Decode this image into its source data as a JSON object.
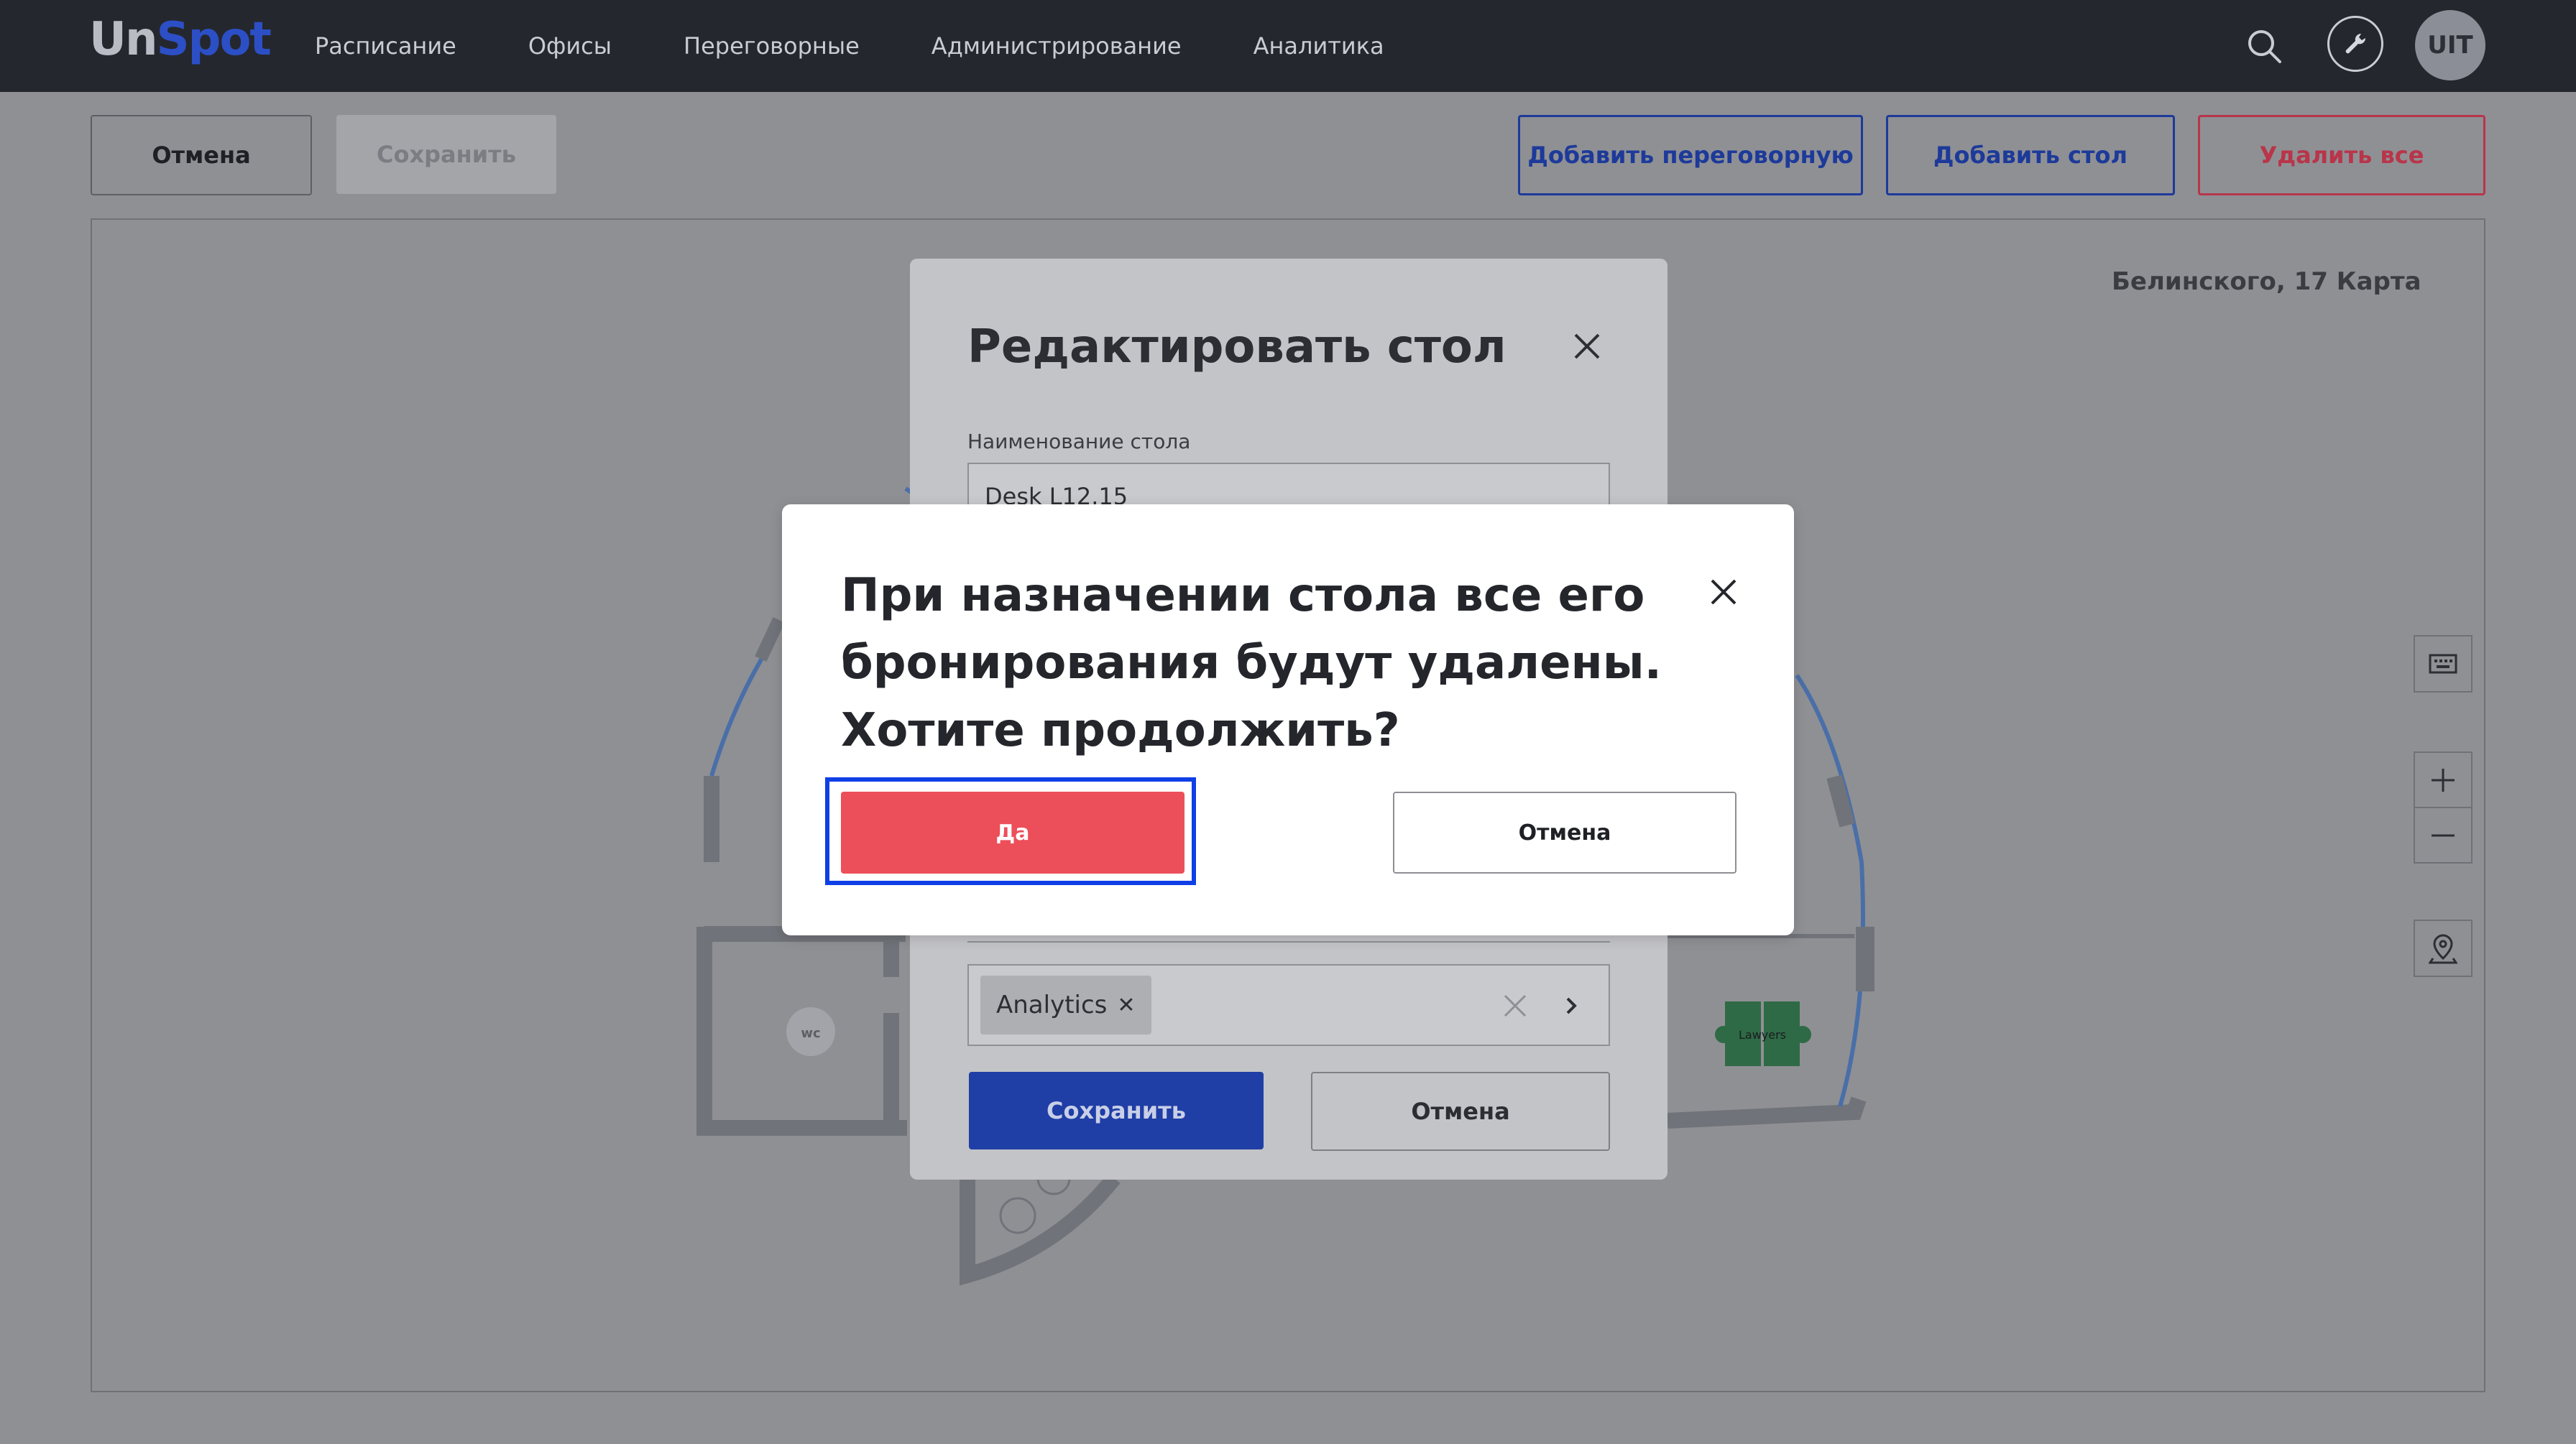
{
  "app": {
    "logo_part1": "Un",
    "logo_part2": "Spot",
    "avatar_initials": "UIT"
  },
  "nav": {
    "items": [
      "Расписание",
      "Офисы",
      "Переговорные",
      "Администрирование",
      "Аналитика"
    ]
  },
  "toolbar": {
    "cancel_label": "Отмена",
    "save_label": "Сохранить",
    "add_room_label": "Добавить переговорную",
    "add_desk_label": "Добавить стол",
    "delete_all_label": "Удалить все"
  },
  "map": {
    "label": "Белинского, 17 Карта",
    "wc_label": "wc",
    "group_label": "Lawyers"
  },
  "edit_dialog": {
    "title": "Редактировать стол",
    "name_label": "Наименование стола",
    "name_value": "Desk L12.15",
    "tag": "Analytics",
    "save_label": "Сохранить",
    "cancel_label": "Отмена"
  },
  "confirm_dialog": {
    "message": "При назначении стола все его бронирования будут удалены. Хотите продолжить?",
    "yes_label": "Да",
    "cancel_label": "Отмена"
  },
  "colors": {
    "accent_blue": "#1f3ea6",
    "danger_red": "#ec4f5a",
    "focus_ring": "#0f3fe6",
    "topbar": "#24272d"
  }
}
